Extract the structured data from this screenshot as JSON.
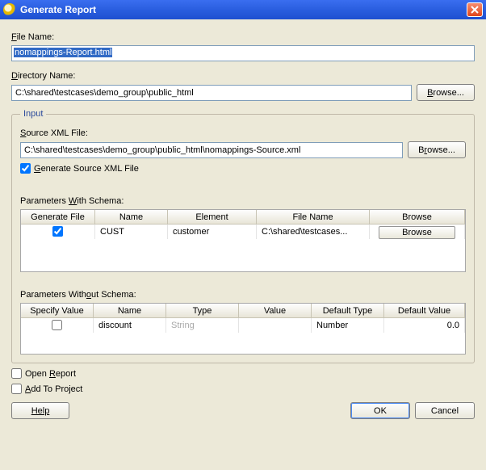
{
  "window": {
    "title": "Generate Report"
  },
  "labels": {
    "file_name": "File Name:",
    "directory_name": "Directory Name:",
    "browse": "Browse...",
    "source_xml": "Source XML File:",
    "gen_source": "Generate Source XML File",
    "params_with": "Parameters With Schema:",
    "params_without": "Parameters Without Schema:",
    "open_report": "Open Report",
    "add_to_project": "Add To Project",
    "help": "Help",
    "ok": "OK",
    "cancel": "Cancel",
    "input_legend": "Input"
  },
  "fields": {
    "file_name": "nomappings-Report.html",
    "directory": "C:\\shared\\testcases\\demo_group\\public_html",
    "source_xml": "C:\\shared\\testcases\\demo_group\\public_html\\nomappings-Source.xml"
  },
  "checks": {
    "gen_source": true,
    "open_report": false,
    "add_to_project": false
  },
  "table_with": {
    "headers": {
      "generate": "Generate File",
      "name": "Name",
      "element": "Element",
      "file": "File Name",
      "browse": "Browse"
    },
    "rows": [
      {
        "generate": true,
        "name": "CUST",
        "element": "customer",
        "file": "C:\\shared\\testcases...",
        "browse_label": "Browse"
      }
    ]
  },
  "table_without": {
    "headers": {
      "specify": "Specify Value",
      "name": "Name",
      "type": "Type",
      "value": "Value",
      "deftype": "Default Type",
      "defval": "Default Value"
    },
    "rows": [
      {
        "specify": false,
        "name": "discount",
        "type": "String",
        "value": "",
        "deftype": "Number",
        "defval": "0.0"
      }
    ]
  }
}
